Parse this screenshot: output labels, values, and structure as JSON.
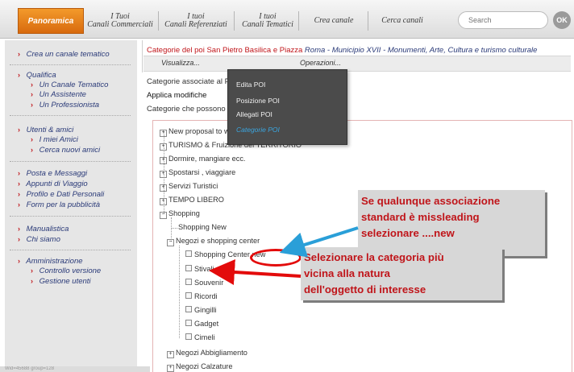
{
  "nav": {
    "home": "Panoramica",
    "tabs": [
      {
        "line1": "I Tuoi",
        "line2": "Canali Commerciali"
      },
      {
        "line1": "I tuoi",
        "line2": "Canali Referenziati"
      },
      {
        "line1": "I tuoi",
        "line2": "Canali Tematici"
      },
      {
        "line1": "Crea canale",
        "line2": ""
      },
      {
        "line1": "Cerca canali",
        "line2": ""
      }
    ],
    "search_placeholder": "Search",
    "ok_label": "OK"
  },
  "sidebar": {
    "items": [
      "Crea un canale tematico",
      "Qualifica",
      "Un Canale Tematico",
      "Un Assistente",
      "Un Professionista",
      "Utenti & amici",
      "I miei Amici",
      "Cerca nuovi amici",
      "Posta e Messaggi",
      "Appunti di Viaggio",
      "Profilo e Dati Personali",
      "Form per la pubblicità",
      "Manualistica",
      "Chi siamo",
      "Amministrazione",
      "Controllo versione",
      "Gestione utenti"
    ],
    "status": "Wid=45688 group=128"
  },
  "breadcrumb": {
    "part1": "Categorie del poi San Pietro Basilica e Piazza",
    "part2": "Roma - Municipio XVII - Monumenti, Arte, Cultura e turismo culturale"
  },
  "menubar": {
    "visualizza": "Visualizza...",
    "operazioni": "Operazioni..."
  },
  "main": {
    "associated": "Categorie associate al POI",
    "apply": "Applica modifiche",
    "possible": "Categorie che possono essere associate al POI"
  },
  "dropdown": [
    "Edita POI",
    "Posizione POI",
    "Allegati POI",
    "Categorie POI"
  ],
  "tree": {
    "top": [
      "New proposal to waltertp@gmail.com",
      "TURISMO & Fruizione del TERRITORIO",
      "Dormire, mangiare ecc.",
      "Spostarsi , viaggiare",
      "Servizi Turistici",
      "TEMPO LIBERO",
      "Shopping"
    ],
    "shopping_new": "Shopping New",
    "negozi_center": "Negozi e shopping center",
    "leaves": [
      "Shopping Center new",
      "Stivali",
      "Souvenir",
      "Ricordi",
      "Gingilli",
      "Gadget",
      "Cimeli"
    ],
    "after": [
      "Negozi Abbigliamento",
      "Negozi Calzature"
    ]
  },
  "annotations": {
    "note1": [
      "Se qualunque associazione",
      "standard è missleading",
      "selezionare ....new"
    ],
    "note2": [
      "Selezionare la categoria  più",
      "vicina alla natura",
      "dell'oggetto di interesse"
    ],
    "color": "#c0151a",
    "arrow_blue": "#2a9fd8",
    "arrow_red": "#e30b0b"
  }
}
